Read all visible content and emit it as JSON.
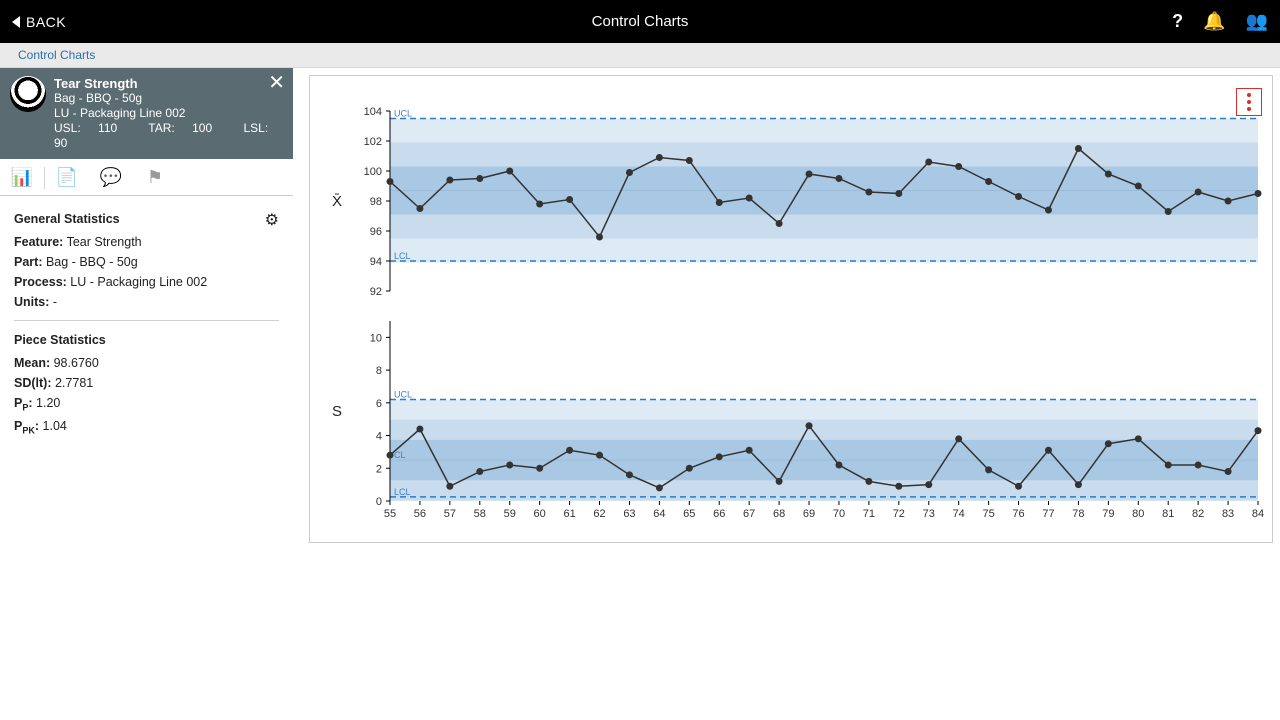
{
  "topbar": {
    "back": "BACK",
    "title": "Control Charts"
  },
  "crumb": "Control Charts",
  "side": {
    "title": "Tear Strength",
    "part": "Bag - BBQ - 50g",
    "process": "LU - Packaging Line 002",
    "spec_usl_label": "USL:",
    "spec_usl": "110",
    "spec_tar_label": "TAR:",
    "spec_tar": "100",
    "spec_lsl_label": "LSL:",
    "spec_lsl": "90"
  },
  "gen": {
    "header": "General Statistics",
    "feature_l": "Feature:",
    "feature_v": "Tear Strength",
    "part_l": "Part:",
    "part_v": "Bag - BBQ - 50g",
    "process_l": "Process:",
    "process_v": "LU - Packaging Line 002",
    "units_l": "Units:",
    "units_v": "-"
  },
  "piece": {
    "header": "Piece Statistics",
    "mean_l": "Mean:",
    "mean_v": "98.6760",
    "sd_l": "SD(lt):",
    "sd_v": "2.7781",
    "pp_l": "P",
    "pp_sub": "P",
    "pp_suf": ":",
    "pp_v": "1.20",
    "ppk_l": "P",
    "ppk_sub": "PK",
    "ppk_suf": ":",
    "ppk_v": "1.04"
  },
  "chart_data": [
    {
      "type": "line",
      "name": "Xbar",
      "ylabel": "X̄",
      "categories": [
        "55",
        "56",
        "57",
        "58",
        "59",
        "60",
        "61",
        "62",
        "63",
        "64",
        "65",
        "66",
        "67",
        "68",
        "69",
        "70",
        "71",
        "72",
        "73",
        "74",
        "75",
        "76",
        "77",
        "78",
        "79",
        "80",
        "81",
        "82",
        "83",
        "84"
      ],
      "values": [
        99.3,
        97.5,
        99.4,
        99.5,
        100.0,
        97.8,
        98.1,
        95.6,
        99.9,
        100.9,
        100.7,
        97.9,
        98.2,
        96.5,
        99.8,
        99.5,
        98.6,
        98.5,
        100.6,
        100.3,
        99.3,
        98.3,
        97.4,
        101.5,
        99.8,
        99.0,
        97.3,
        98.6,
        98.0,
        98.5
      ],
      "ylim": [
        92,
        104
      ],
      "ucl": 103.5,
      "lcl": 94.0,
      "cl": 98.7,
      "ucl_label": "UCL",
      "lcl_label": "LCL",
      "yticks": [
        92,
        94,
        96,
        98,
        100,
        102,
        104
      ]
    },
    {
      "type": "line",
      "name": "S",
      "ylabel": "S",
      "categories": [
        "55",
        "56",
        "57",
        "58",
        "59",
        "60",
        "61",
        "62",
        "63",
        "64",
        "65",
        "66",
        "67",
        "68",
        "69",
        "70",
        "71",
        "72",
        "73",
        "74",
        "75",
        "76",
        "77",
        "78",
        "79",
        "80",
        "81",
        "82",
        "83",
        "84"
      ],
      "values": [
        2.8,
        4.4,
        0.9,
        1.8,
        2.2,
        2.0,
        3.1,
        2.8,
        1.6,
        0.8,
        2.0,
        2.7,
        3.1,
        1.2,
        4.6,
        2.2,
        1.2,
        0.9,
        1.0,
        3.8,
        1.9,
        0.9,
        3.1,
        1.0,
        3.5,
        3.8,
        2.2,
        2.2,
        1.8,
        4.3
      ],
      "ylim": [
        0,
        11
      ],
      "ucl": 6.2,
      "lcl": 0.25,
      "cl": 2.5,
      "ucl_label": "UCL",
      "cl_label": "CL",
      "lcl_label": "LCL",
      "yticks": [
        0,
        2,
        4,
        6,
        8,
        10
      ]
    }
  ]
}
